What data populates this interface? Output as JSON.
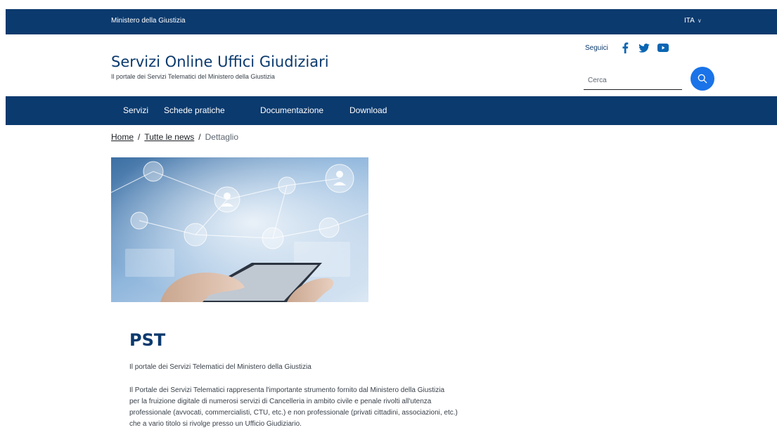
{
  "topbar": {
    "ministry": "Ministero della Giustizia",
    "language": "ITA"
  },
  "header": {
    "title": "Servizi Online Uffici Giudiziari",
    "subtitle": "Il portale dei Servizi Telematici del Ministero della Giustizia",
    "follow_label": "Seguici",
    "social": [
      "facebook-icon",
      "twitter-icon",
      "youtube-icon"
    ],
    "search_placeholder": "Cerca"
  },
  "nav": {
    "items": [
      "Servizi",
      "Schede pratiche",
      "Documentazione",
      "Download"
    ]
  },
  "breadcrumb": {
    "home": "Home",
    "news": "Tutte le news",
    "current": "Dettaglio",
    "separator": "/"
  },
  "article": {
    "title": "PST",
    "lead": "Il portale dei Servizi Telematici del Ministero della Giustizia",
    "body": [
      "Il Portale dei Servizi Telematici rappresenta l'importante strumento fornito dal Ministero della Giustizia",
      "per la fruizione digitale di numerosi servizi di Cancelleria in ambito civile e penale rivolti all'utenza",
      "professionale (avvocati, commercialisti, CTU, etc.) e non professionale (privati cittadini, associazioni, etc.)",
      "che a vario titolo si rivolge presso un Ufficio Giudiziario."
    ]
  },
  "colors": {
    "primary": "#0b3a6e",
    "search_button": "#1a73e8",
    "social": "#0b66b3"
  }
}
